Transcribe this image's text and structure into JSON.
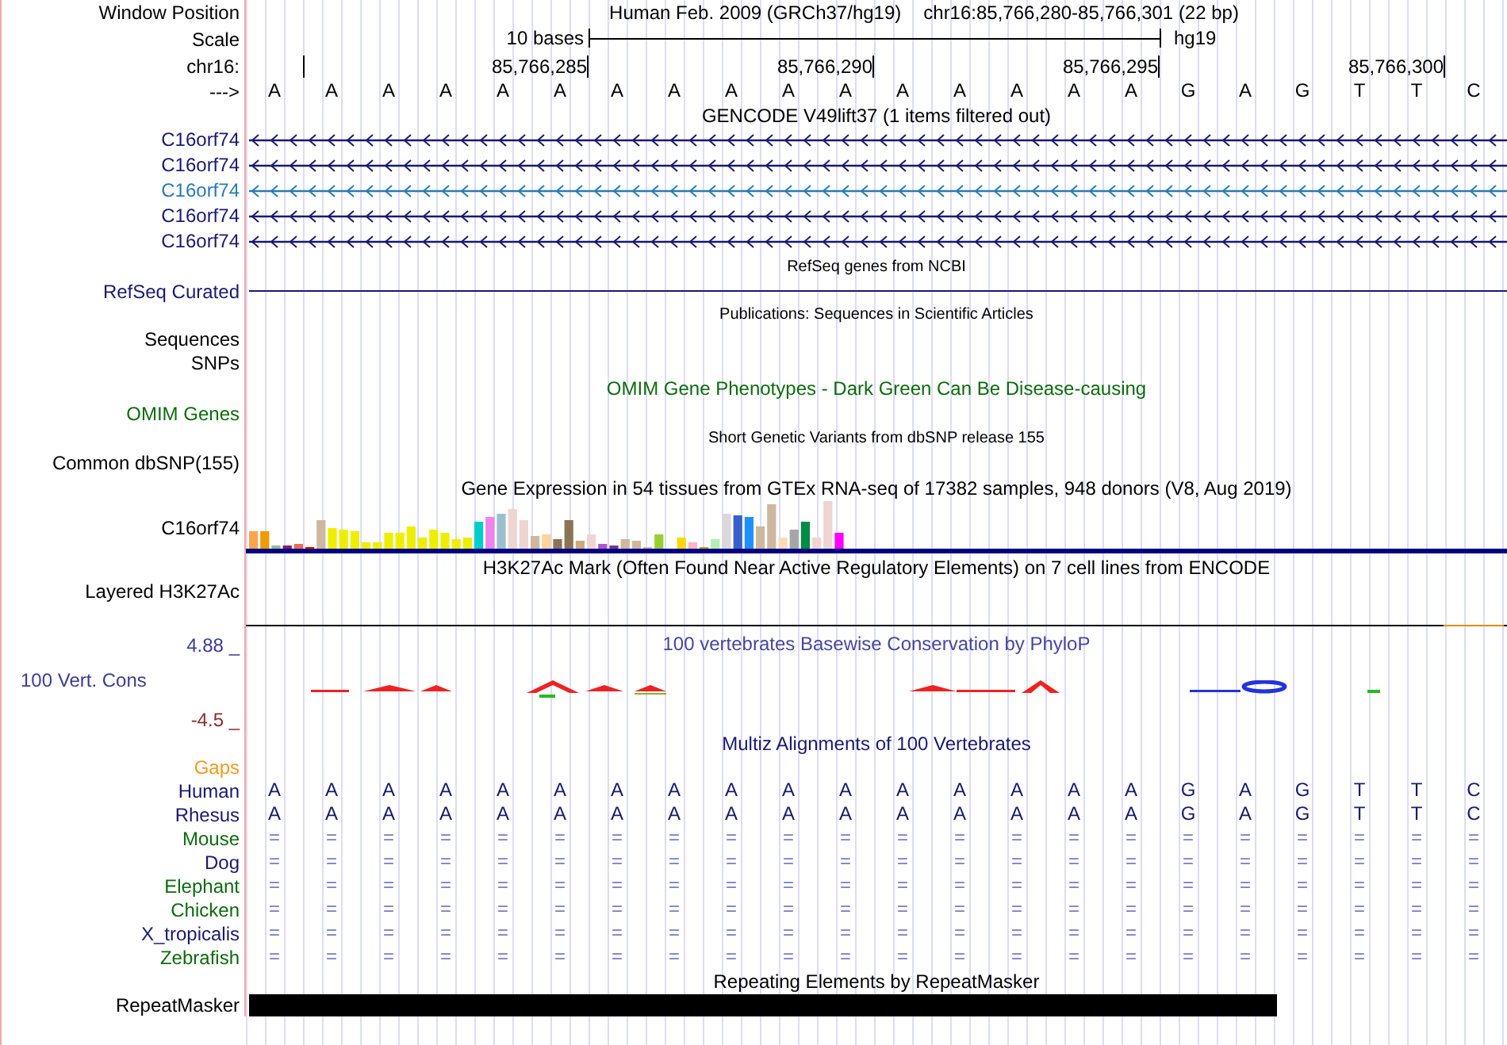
{
  "position": {
    "label": "Window Position",
    "assembly": "Human Feb. 2009 (GRCh37/hg19)",
    "range": "chr16:85,766,280-85,766,301 (22 bp)"
  },
  "scale": {
    "label": "Scale",
    "span": "10 bases",
    "assembly": "hg19"
  },
  "ruler": {
    "label": "chr16:",
    "ticks": [
      "85,766,285",
      "85,766,290",
      "85,766,295",
      "85,766,300"
    ]
  },
  "sequence": {
    "label": "--->",
    "bases": [
      "A",
      "A",
      "A",
      "A",
      "A",
      "A",
      "A",
      "A",
      "A",
      "A",
      "A",
      "A",
      "A",
      "A",
      "A",
      "A",
      "G",
      "A",
      "G",
      "T",
      "T",
      "C"
    ]
  },
  "gencode": {
    "title": "GENCODE V49lift37 (1 items filtered out)",
    "genes": [
      {
        "name": "C16orf74",
        "color": "#191970"
      },
      {
        "name": "C16orf74",
        "color": "#191970"
      },
      {
        "name": "C16orf74",
        "color": "#2a7ab5"
      },
      {
        "name": "C16orf74",
        "color": "#191970"
      },
      {
        "name": "C16orf74",
        "color": "#191970"
      }
    ]
  },
  "refseq": {
    "title": "RefSeq genes from NCBI",
    "label": "RefSeq Curated"
  },
  "publications": {
    "title": "Publications: Sequences in Scientific Articles",
    "labels": [
      "Sequences",
      "SNPs"
    ]
  },
  "omim": {
    "title": "OMIM Gene Phenotypes - Dark Green Can Be Disease-causing",
    "label": "OMIM Genes"
  },
  "dbsnp": {
    "title": "Short Genetic Variants from dbSNP release 155",
    "label": "Common dbSNP(155)"
  },
  "gtex": {
    "title": "Gene Expression in 54 tissues from GTEx RNA-seq of 17382 samples, 948 donors (V8, Aug 2019)",
    "label": "C16orf74"
  },
  "h3k27ac": {
    "title": "H3K27Ac Mark (Often Found Near Active Regulatory Elements) on 7 cell lines from ENCODE",
    "label": "Layered H3K27Ac"
  },
  "conservation": {
    "title": "100 vertebrates Basewise Conservation by PhyloP",
    "label": "100 Vert. Cons",
    "max": "4.88 _",
    "min": "-4.5 _"
  },
  "multiz": {
    "title": "Multiz Alignments of 100 Vertebrates",
    "gaps_label": "Gaps",
    "species": [
      {
        "name": "Human",
        "color": "#191970",
        "kind": "bases",
        "cells": [
          "A",
          "A",
          "A",
          "A",
          "A",
          "A",
          "A",
          "A",
          "A",
          "A",
          "A",
          "A",
          "A",
          "A",
          "A",
          "A",
          "G",
          "A",
          "G",
          "T",
          "T",
          "C"
        ]
      },
      {
        "name": "Rhesus",
        "color": "#191970",
        "kind": "bases",
        "cells": [
          "A",
          "A",
          "A",
          "A",
          "A",
          "A",
          "A",
          "A",
          "A",
          "A",
          "A",
          "A",
          "A",
          "A",
          "A",
          "A",
          "G",
          "A",
          "G",
          "T",
          "T",
          "C"
        ]
      },
      {
        "name": "Mouse",
        "color": "#0d6b0d",
        "kind": "match",
        "cells": [
          "=",
          "=",
          "=",
          "=",
          "=",
          "=",
          "=",
          "=",
          "=",
          "=",
          "=",
          "=",
          "=",
          "=",
          "=",
          "=",
          "=",
          "=",
          "=",
          "=",
          "=",
          "="
        ]
      },
      {
        "name": "Dog",
        "color": "#191970",
        "kind": "match",
        "cells": [
          "=",
          "=",
          "=",
          "=",
          "=",
          "=",
          "=",
          "=",
          "=",
          "=",
          "=",
          "=",
          "=",
          "=",
          "=",
          "=",
          "=",
          "=",
          "=",
          "=",
          "=",
          "="
        ]
      },
      {
        "name": "Elephant",
        "color": "#0d6b0d",
        "kind": "match",
        "cells": [
          "=",
          "=",
          "=",
          "=",
          "=",
          "=",
          "=",
          "=",
          "=",
          "=",
          "=",
          "=",
          "=",
          "=",
          "=",
          "=",
          "=",
          "=",
          "=",
          "=",
          "=",
          "="
        ]
      },
      {
        "name": "Chicken",
        "color": "#0d6b0d",
        "kind": "match",
        "cells": [
          "=",
          "=",
          "=",
          "=",
          "=",
          "=",
          "=",
          "=",
          "=",
          "=",
          "=",
          "=",
          "=",
          "=",
          "=",
          "=",
          "=",
          "=",
          "=",
          "=",
          "=",
          "="
        ]
      },
      {
        "name": "X_tropicalis",
        "color": "#191970",
        "kind": "match",
        "cells": [
          "=",
          "=",
          "=",
          "=",
          "=",
          "=",
          "=",
          "=",
          "=",
          "=",
          "=",
          "=",
          "=",
          "=",
          "=",
          "=",
          "=",
          "=",
          "=",
          "=",
          "=",
          "="
        ]
      },
      {
        "name": "Zebrafish",
        "color": "#0d6b0d",
        "kind": "match",
        "cells": [
          "=",
          "=",
          "=",
          "=",
          "=",
          "=",
          "=",
          "=",
          "=",
          "=",
          "=",
          "=",
          "=",
          "=",
          "=",
          "=",
          "=",
          "=",
          "=",
          "=",
          "=",
          "="
        ]
      }
    ]
  },
  "repeatmasker": {
    "title": "Repeating Elements by RepeatMasker",
    "label": "RepeatMasker"
  }
}
